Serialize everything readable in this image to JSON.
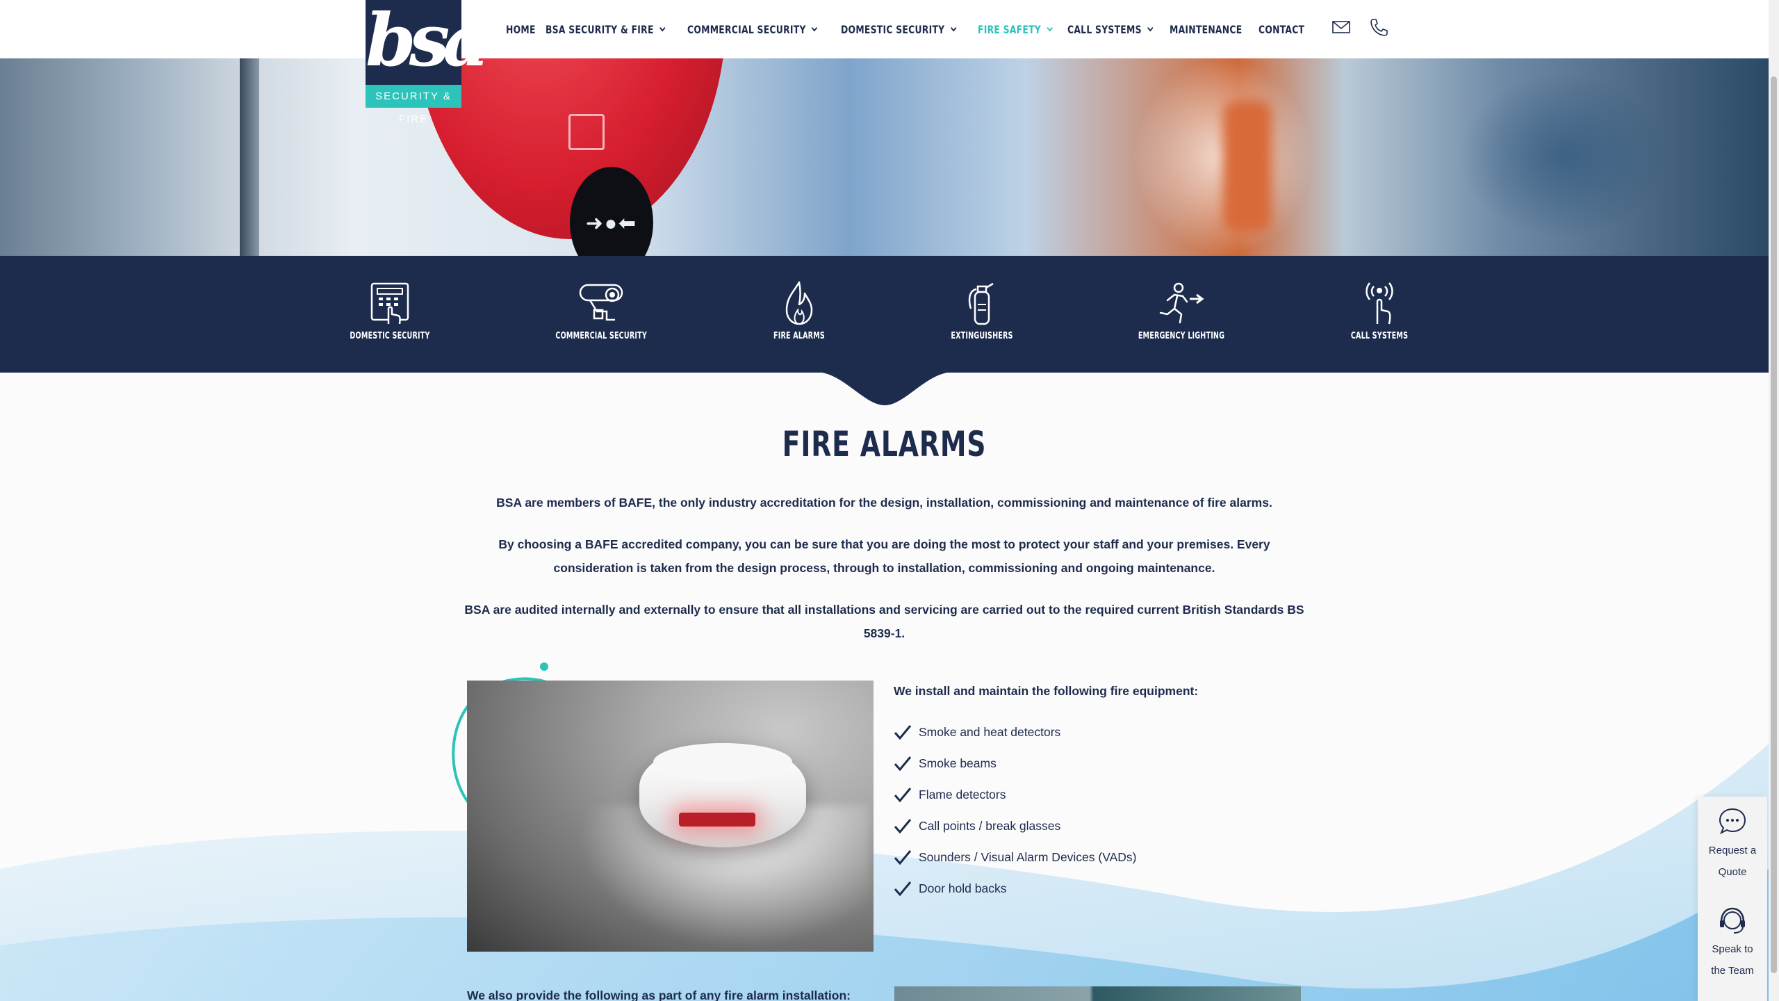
{
  "brand": {
    "logo_text": "bsa",
    "tagline": "SECURITY & FIRE"
  },
  "nav": [
    {
      "label": "HOME",
      "has_dropdown": false,
      "active": false
    },
    {
      "label": "BSA SECURITY & FIRE",
      "has_dropdown": true,
      "active": false
    },
    {
      "label": "COMMERCIAL SECURITY",
      "has_dropdown": true,
      "active": false
    },
    {
      "label": "DOMESTIC SECURITY",
      "has_dropdown": true,
      "active": false
    },
    {
      "label": "FIRE SAFETY",
      "has_dropdown": true,
      "active": true
    },
    {
      "label": "CALL SYSTEMS",
      "has_dropdown": true,
      "active": false
    },
    {
      "label": "MAINTENANCE",
      "has_dropdown": false,
      "active": false
    },
    {
      "label": "CONTACT",
      "has_dropdown": false,
      "active": false
    }
  ],
  "header_icons": [
    "envelope-icon",
    "phone-icon"
  ],
  "categories": [
    {
      "label": "DOMESTIC SECURITY",
      "icon": "keypad-icon"
    },
    {
      "label": "COMMERCIAL SECURITY",
      "icon": "cctv-camera-icon"
    },
    {
      "label": "FIRE ALARMS",
      "icon": "flame-icon"
    },
    {
      "label": "EXTINGUISHERS",
      "icon": "extinguisher-icon"
    },
    {
      "label": "EMERGENCY LIGHTING",
      "icon": "running-man-exit-icon"
    },
    {
      "label": "CALL SYSTEMS",
      "icon": "call-button-icon"
    }
  ],
  "section": {
    "title": "FIRE ALARMS",
    "para1": "BSA are members of BAFE, the only industry accreditation for the design, installation, commissioning and maintenance of fire alarms.",
    "para2": "By choosing a BAFE accredited company, you can be sure that you are doing the most to protect your staff and your premises. Every consideration is taken from the design process, through to installation, commissioning and ongoing maintenance.",
    "para3": "BSA are audited internally and externally to ensure that all installations and servicing are carried out to the required current British Standards BS 5839-1.",
    "list_title": "We install and maintain the following fire equipment:",
    "equipment": [
      "Smoke and heat detectors",
      "Smoke beams",
      "Flame detectors",
      "Call points / break glasses",
      "Sounders / Visual Alarm Devices (VADs)",
      "Door hold backs"
    ],
    "also_title": "We also provide the following as part of any fire alarm installation:"
  },
  "side_widget": [
    {
      "label_line1": "Request a",
      "label_line2": "Quote",
      "icon": "chat-bubble-icon"
    },
    {
      "label_line1": "Speak to",
      "label_line2": "the Team",
      "icon": "headset-icon"
    }
  ],
  "colors": {
    "navy": "#1d2b4d",
    "teal": "#2cc3ba",
    "white": "#ffffff"
  }
}
